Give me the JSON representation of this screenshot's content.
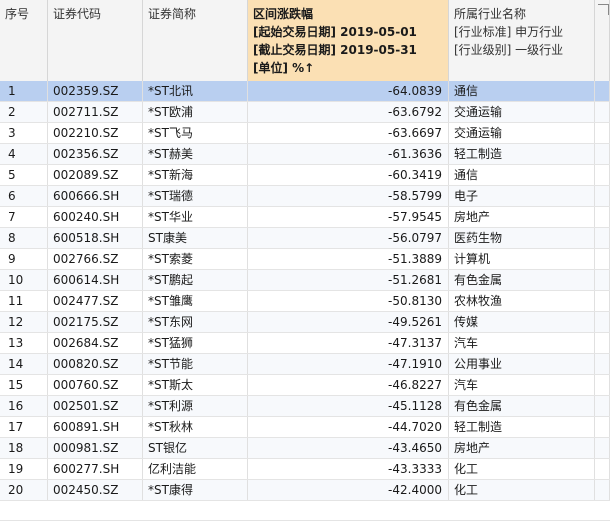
{
  "header": {
    "col_index": "序号",
    "col_code": "证券代码",
    "col_name": "证券简称",
    "col_change": {
      "title": "区间涨跌幅",
      "start": "[起始交易日期] 2019-05-01",
      "end": "[截止交易日期] 2019-05-31",
      "unit": "[单位] %↑"
    },
    "col_industry": {
      "title": "所属行业名称",
      "standard": "[行业标准] 申万行业",
      "level": "[行业级别] 一级行业"
    }
  },
  "rows": [
    {
      "index": "1",
      "code": "002359.SZ",
      "name": "*ST北讯",
      "change": "-64.0839",
      "industry": "通信"
    },
    {
      "index": "2",
      "code": "002711.SZ",
      "name": "*ST欧浦",
      "change": "-63.6792",
      "industry": "交通运输"
    },
    {
      "index": "3",
      "code": "002210.SZ",
      "name": "*ST飞马",
      "change": "-63.6697",
      "industry": "交通运输"
    },
    {
      "index": "4",
      "code": "002356.SZ",
      "name": "*ST赫美",
      "change": "-61.3636",
      "industry": "轻工制造"
    },
    {
      "index": "5",
      "code": "002089.SZ",
      "name": "*ST新海",
      "change": "-60.3419",
      "industry": "通信"
    },
    {
      "index": "6",
      "code": "600666.SH",
      "name": "*ST瑞德",
      "change": "-58.5799",
      "industry": "电子"
    },
    {
      "index": "7",
      "code": "600240.SH",
      "name": "*ST华业",
      "change": "-57.9545",
      "industry": "房地产"
    },
    {
      "index": "8",
      "code": "600518.SH",
      "name": "ST康美",
      "change": "-56.0797",
      "industry": "医药生物"
    },
    {
      "index": "9",
      "code": "002766.SZ",
      "name": "*ST索菱",
      "change": "-51.3889",
      "industry": "计算机"
    },
    {
      "index": "10",
      "code": "600614.SH",
      "name": "*ST鹏起",
      "change": "-51.2681",
      "industry": "有色金属"
    },
    {
      "index": "11",
      "code": "002477.SZ",
      "name": "*ST雏鹰",
      "change": "-50.8130",
      "industry": "农林牧渔"
    },
    {
      "index": "12",
      "code": "002175.SZ",
      "name": "*ST东网",
      "change": "-49.5261",
      "industry": "传媒"
    },
    {
      "index": "13",
      "code": "002684.SZ",
      "name": "*ST猛狮",
      "change": "-47.3137",
      "industry": "汽车"
    },
    {
      "index": "14",
      "code": "000820.SZ",
      "name": "*ST节能",
      "change": "-47.1910",
      "industry": "公用事业"
    },
    {
      "index": "15",
      "code": "000760.SZ",
      "name": "*ST斯太",
      "change": "-46.8227",
      "industry": "汽车"
    },
    {
      "index": "16",
      "code": "002501.SZ",
      "name": "*ST利源",
      "change": "-45.1128",
      "industry": "有色金属"
    },
    {
      "index": "17",
      "code": "600891.SH",
      "name": "*ST秋林",
      "change": "-44.7020",
      "industry": "轻工制造"
    },
    {
      "index": "18",
      "code": "000981.SZ",
      "name": "ST银亿",
      "change": "-43.4650",
      "industry": "房地产"
    },
    {
      "index": "19",
      "code": "600277.SH",
      "name": "亿利洁能",
      "change": "-43.3333",
      "industry": "化工"
    },
    {
      "index": "20",
      "code": "002450.SZ",
      "name": "*ST康得",
      "change": "-42.4000",
      "industry": "化工"
    }
  ],
  "selected_row": "1"
}
